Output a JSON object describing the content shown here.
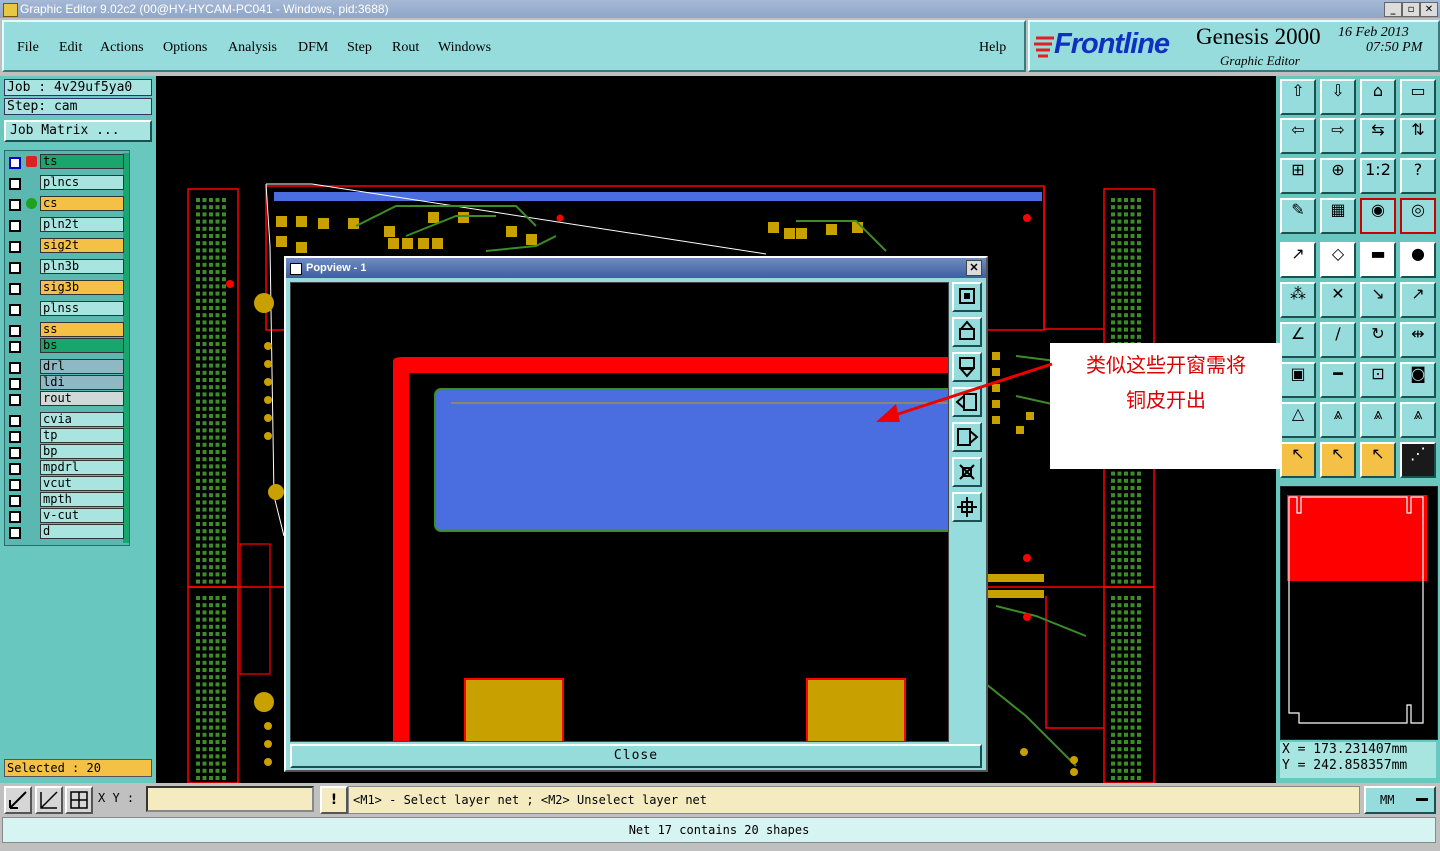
{
  "window": {
    "title": "Graphic Editor 9.02c2 (00@HY-HYCAM-PC041 - Windows, pid:3688)"
  },
  "menu": [
    "File",
    "Edit",
    "Actions",
    "Options",
    "Analysis",
    "DFM",
    "Step",
    "Rout",
    "Windows"
  ],
  "help_label": "Help",
  "brand": {
    "logo": "Frontline",
    "product": "Genesis 2000",
    "subtitle": "Graphic Editor",
    "date": "16 Feb 2013",
    "time": "07:50 PM"
  },
  "job": {
    "job_label": "Job : 4v29uf5ya0",
    "step_label": "Step: cam",
    "matrix_button": "Job Matrix ..."
  },
  "layers": [
    {
      "name": "ts",
      "color": "#1aa56e"
    },
    {
      "name": "plncs",
      "color": "#a8e4e0"
    },
    {
      "name": "cs",
      "color": "#f5c046"
    },
    {
      "name": "pln2t",
      "color": "#a8e4e0"
    },
    {
      "name": "sig2t",
      "color": "#f5c046"
    },
    {
      "name": "pln3b",
      "color": "#a8e4e0"
    },
    {
      "name": "sig3b",
      "color": "#f5c046"
    },
    {
      "name": "plnss",
      "color": "#a8e4e0"
    },
    {
      "name": "ss",
      "color": "#f5c046"
    },
    {
      "name": "bs",
      "color": "#1aa56e"
    },
    {
      "name": "drl",
      "color": "#8fb8c4"
    },
    {
      "name": "ldi",
      "color": "#8fb8c4"
    },
    {
      "name": "rout",
      "color": "#d0d8d8"
    },
    {
      "name": "cvia",
      "color": "#a8e4e0"
    },
    {
      "name": "tp",
      "color": "#a8e4e0"
    },
    {
      "name": "bp",
      "color": "#a8e4e0"
    },
    {
      "name": "mpdrl",
      "color": "#a8e4e0"
    },
    {
      "name": "vcut",
      "color": "#a8e4e0"
    },
    {
      "name": "mpth",
      "color": "#a8e4e0"
    },
    {
      "name": "v-cut",
      "color": "#a8e4e0"
    },
    {
      "name": "d",
      "color": "#a8e4e0"
    }
  ],
  "selected_label": "Selected : 20",
  "popview": {
    "title": "Popview - 1",
    "close_label": "Close"
  },
  "annotation": {
    "line1": "类似这些开窗需将",
    "line2": "铜皮开出"
  },
  "coords": {
    "x": "X  =  173.231407mm",
    "y": "Y  =  242.858357mm"
  },
  "command": {
    "xy_label": "X Y :",
    "input_value": "",
    "prompt": "<M1> - Select layer net ; <M2> Unselect layer net",
    "units": "MM"
  },
  "status": "Net 17 contains 20 shapes",
  "toolbar_icons": [
    "zoom-home-icon",
    "zoom-in-icon",
    "home-icon",
    "window-icon",
    "pan-left-icon",
    "pan-right-icon",
    "mirror-icon",
    "flip-icon",
    "fit-icon",
    "center-icon",
    "scale-1to1-icon",
    "help-query-icon",
    "palette-icon",
    "grid-icon",
    "snap-pad-icon",
    "snap-net-icon",
    "add-feature-icon",
    "edit-shape-icon",
    "ruler-icon",
    "pad-icon",
    "connect-icon",
    "cross-icon",
    "move-pad-icon",
    "copy-pad-icon",
    "draw-line-icon",
    "cut-line-icon",
    "arc-icon",
    "split-icon",
    "pad-measure-icon",
    "bar-icon",
    "measure-icon",
    "snap-circles-icon",
    "triangle-icon",
    "triangle-a-icon",
    "triangle-b-icon",
    "triangle-c-icon",
    "pointer-icon",
    "select-pointer-icon",
    "select-area-icon",
    "net-select-icon"
  ],
  "colors": {
    "panel": "#96dcdc",
    "canvas": "#000000",
    "copper_red": "#ff0000",
    "copper_blue": "#4a6ee0",
    "pad_gold": "#c8a000",
    "trace_green": "#3c8c28"
  }
}
